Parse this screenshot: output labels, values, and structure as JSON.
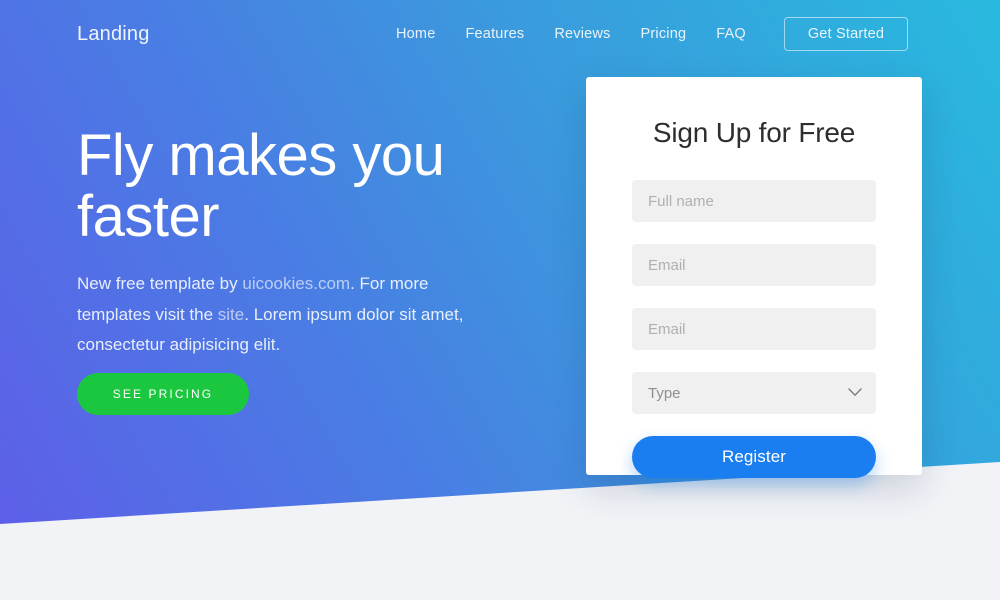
{
  "nav": {
    "brand": "Landing",
    "links": [
      {
        "label": "Home"
      },
      {
        "label": "Features"
      },
      {
        "label": "Reviews"
      },
      {
        "label": "Pricing"
      },
      {
        "label": "FAQ"
      }
    ],
    "cta_label": "Get Started"
  },
  "hero": {
    "title": "Fly makes you faster",
    "paragraph": {
      "part1": "New free template by ",
      "link1": "uicookies.com",
      "part2": ". For more templates visit the ",
      "link2": "site",
      "part3": ". Lorem ipsum dolor sit amet, consectetur adipisicing elit."
    },
    "cta_label": "See Pricing"
  },
  "signup": {
    "title": "Sign Up for Free",
    "fields": [
      {
        "name": "full-name",
        "placeholder": "Full name",
        "value": ""
      },
      {
        "name": "email",
        "placeholder": "Email",
        "value": ""
      },
      {
        "name": "email-confirm",
        "placeholder": "Email",
        "value": ""
      }
    ],
    "select": {
      "label": "Type",
      "icon": "chevron-down-icon"
    },
    "submit_label": "Register"
  },
  "colors": {
    "gradient_start": "#5d5fe8",
    "gradient_end": "#28b9de",
    "green_cta": "#1cc740",
    "blue_cta": "#1a7ef0",
    "page_background": "#f1f3f7",
    "card_background": "#ffffff",
    "field_background": "#f0f0f0"
  }
}
